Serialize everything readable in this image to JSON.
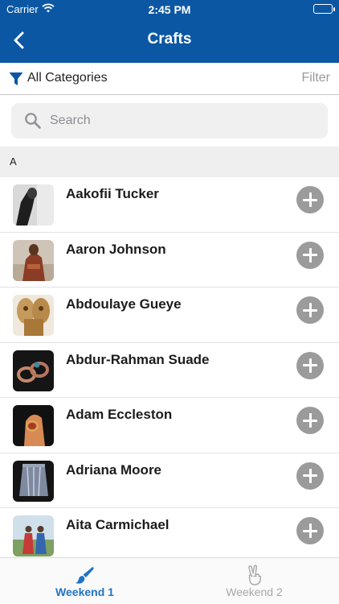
{
  "status_bar": {
    "carrier": "Carrier",
    "time": "2:45 PM"
  },
  "nav": {
    "title": "Crafts",
    "back_icon": "chevron-left-icon"
  },
  "filter": {
    "category": "All Categories",
    "link": "Filter",
    "icon": "funnel-icon"
  },
  "search": {
    "placeholder": "Search",
    "value": ""
  },
  "section": {
    "letter": "A"
  },
  "items": [
    {
      "name": "Aakofii Tucker"
    },
    {
      "name": "Aaron Johnson"
    },
    {
      "name": "Abdoulaye Gueye"
    },
    {
      "name": "Abdur-Rahman Suade"
    },
    {
      "name": "Adam Eccleston"
    },
    {
      "name": "Adriana Moore"
    },
    {
      "name": "Aita Carmichael"
    }
  ],
  "tabs": [
    {
      "label": "Weekend 1",
      "icon": "paintbrush-icon",
      "active": true
    },
    {
      "label": "Weekend 2",
      "icon": "peace-hand-icon",
      "active": false
    }
  ],
  "colors": {
    "brand": "#0b57a4",
    "active_tab": "#1f74c6",
    "inactive_tab": "#a8a8a8",
    "add_button": "#9b9b9b"
  }
}
